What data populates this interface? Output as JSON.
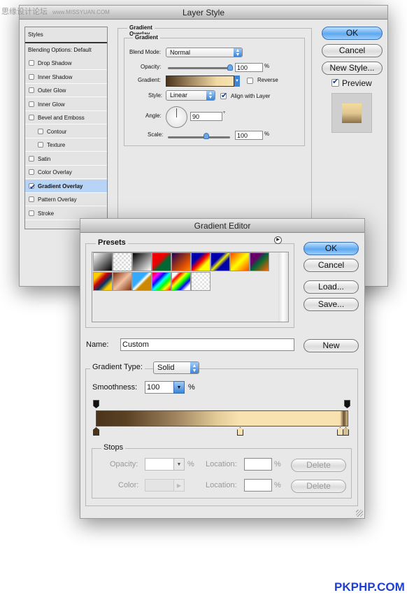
{
  "watermark": {
    "text": "思缘设计论坛",
    "url_text": "www.MISSYUAN.COM"
  },
  "footer_brand": "PKPHP.COM",
  "layer_style": {
    "title": "Layer Style",
    "styles_header": "Styles",
    "blending_options": "Blending Options: Default",
    "items": [
      {
        "label": "Drop Shadow",
        "checked": false
      },
      {
        "label": "Inner Shadow",
        "checked": false
      },
      {
        "label": "Outer Glow",
        "checked": false
      },
      {
        "label": "Inner Glow",
        "checked": false
      },
      {
        "label": "Bevel and Emboss",
        "checked": false
      },
      {
        "label": "Contour",
        "checked": false
      },
      {
        "label": "Texture",
        "checked": false
      },
      {
        "label": "Satin",
        "checked": false
      },
      {
        "label": "Color Overlay",
        "checked": false
      },
      {
        "label": "Gradient Overlay",
        "checked": true,
        "selected": true
      },
      {
        "label": "Pattern Overlay",
        "checked": false
      },
      {
        "label": "Stroke",
        "checked": false
      }
    ],
    "section_title": "Gradient Overlay",
    "group_title": "Gradient",
    "blend_mode_label": "Blend Mode:",
    "blend_mode": "Normal",
    "opacity_label": "Opacity:",
    "opacity": "100",
    "opacity_unit": "%",
    "opacity_fraction": 1.0,
    "gradient_label": "Gradient:",
    "reverse_label": "Reverse",
    "reverse": false,
    "style_label": "Style:",
    "style": "Linear",
    "align_label": "Align with Layer",
    "align": true,
    "angle_label": "Angle:",
    "angle": "90",
    "angle_unit": "°",
    "scale_label": "Scale:",
    "scale": "100",
    "scale_unit": "%",
    "scale_slider_fraction": 0.6,
    "ok": "OK",
    "cancel": "Cancel",
    "new_style": "New Style...",
    "preview_label": "Preview",
    "preview": true
  },
  "gradient_editor": {
    "title": "Gradient Editor",
    "presets_label": "Presets",
    "ok": "OK",
    "cancel": "Cancel",
    "load": "Load...",
    "save": "Save...",
    "name_label": "Name:",
    "name": "Custom",
    "new": "New",
    "type_label": "Gradient Type:",
    "type": "Solid",
    "smoothness_label": "Smoothness:",
    "smoothness": "100",
    "smoothness_unit": "%",
    "colors": {
      "dark": "#4a3419",
      "light": "#f8e3b0"
    },
    "stops_label": "Stops",
    "opacity_label": "Opacity:",
    "opacity_unit": "%",
    "location_label": "Location:",
    "location_unit": "%",
    "color_label": "Color:",
    "delete": "Delete"
  }
}
